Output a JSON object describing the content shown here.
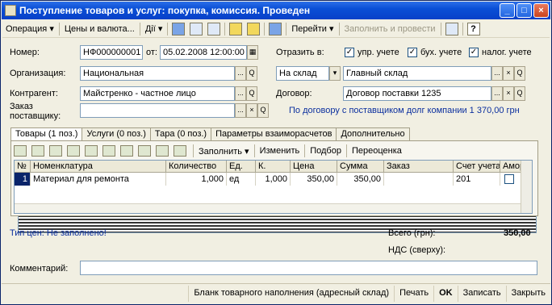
{
  "window": {
    "title": "Поступление товаров и услуг: покупка, комиссия. Проведен",
    "btn_min": "_",
    "btn_max": "□",
    "btn_close": "×"
  },
  "toolbar": {
    "operation": "Операция ▾",
    "prices": "Цены и валюта...",
    "actions": "Дії ▾",
    "goto": "Перейти ▾",
    "fill_post": "Заполнить и провести",
    "help": "?"
  },
  "form": {
    "number_label": "Номер:",
    "number_value": "НФ000000001",
    "from_label": "от:",
    "date_value": "05.02.2008 12:00:00",
    "reflect_label": "Отразить в:",
    "chk_mgmt": "упр. учете",
    "chk_acc": "бух. учете",
    "chk_tax": "налог. учете",
    "org_label": "Организация:",
    "org_value": "Национальная",
    "to_wh_value": "На склад",
    "warehouse_value": "Главный склад",
    "counterparty_label": "Контрагент:",
    "counterparty_value": "Майстренко - частное лицо",
    "contract_label": "Договор:",
    "contract_value": "Договор поставки 1235",
    "order_label_1": "Заказ",
    "order_label_2": "поставщику:",
    "order_value": "",
    "debt_link": "По договору с поставщиком долг компании 1 370,00 грн",
    "sel": "...",
    "clr": "×",
    "look": "Q"
  },
  "tabs": [
    {
      "label": "Товары (1 поз.)"
    },
    {
      "label": "Услуги (0 поз.)"
    },
    {
      "label": "Тара (0 поз.)"
    },
    {
      "label": "Параметры взаиморасчетов"
    },
    {
      "label": "Дополнительно"
    }
  ],
  "inner_toolbar": {
    "fill": "Заполнить ▾",
    "change": "Изменить",
    "select": "Подбор",
    "revalue": "Переоценка"
  },
  "grid": {
    "columns": [
      "№",
      "Номенклатура",
      "Количество",
      "Ед.",
      "К.",
      "Цена",
      "Сумма",
      "Заказ",
      "Счет учета",
      "Аморт."
    ],
    "rows": [
      {
        "n": "1",
        "item": "Материал для ремонта",
        "qty": "1,000",
        "unit": "ед",
        "k": "1,000",
        "price": "350,00",
        "sum": "350,00",
        "order": "",
        "account": "201",
        "amort": ""
      }
    ]
  },
  "footer": {
    "price_type": "Тип цен: Не заполнено!",
    "total_label": "Всего (грн):",
    "total_value": "350,00",
    "vat_label": "НДС (сверху):",
    "vat_value": "",
    "comment_label": "Комментарий:",
    "comment_value": ""
  },
  "bottom": {
    "blank": "Бланк товарного наполнения (адресный склад)",
    "print": "Печать",
    "ok": "OK",
    "save": "Записать",
    "close": "Закрыть"
  }
}
